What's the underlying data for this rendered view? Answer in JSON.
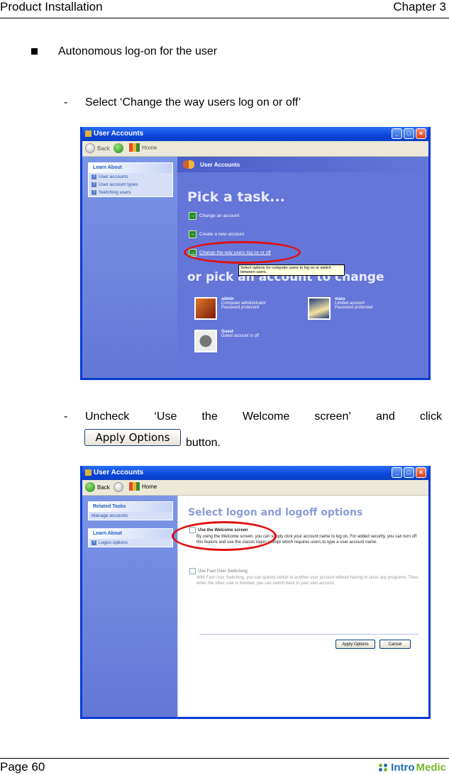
{
  "page": {
    "header_left": "Product Installation",
    "header_right": "Chapter 3",
    "footer_left": "Page 60",
    "logo": {
      "part1": "Intro",
      "part2": "Medic",
      "colors": [
        "#1e6fae",
        "#77b82a"
      ]
    }
  },
  "content": {
    "bullet": "Autonomous log-on for the user",
    "step1_dash": "-",
    "step1": "Select ‘Change the way users log on or off’",
    "step2_dash": "-",
    "step2_words": [
      "Uncheck",
      "‘Use",
      "the",
      "Welcome",
      "screen’",
      "and",
      "click"
    ],
    "step2_button": "Apply Options",
    "step2_suffix": "button."
  },
  "screenshot1": {
    "title": "User Accounts",
    "toolbar": {
      "back": "Back",
      "home": "Home"
    },
    "window_buttons": {
      "minimize": "_",
      "maximize": "□",
      "close": "×"
    },
    "learn_about": {
      "title": "Learn About",
      "items": [
        "User accounts",
        "User account types",
        "Switching users"
      ]
    },
    "main_header": "User Accounts",
    "pick_task": "Pick a task...",
    "tasks": [
      "Change an account",
      "Create a new account",
      "Change the way users log on or off"
    ],
    "tooltip": "Select options for computer users to log on or switch between users.",
    "pick_account": "or pick an account to change",
    "accounts": [
      {
        "name": "admin",
        "lines": [
          "Computer administrator",
          "Password protected"
        ],
        "color": "#a8341c"
      },
      {
        "name": "mara",
        "lines": [
          "Limited account",
          "Password protected"
        ],
        "color": "#2d5a9a"
      },
      {
        "name": "Guest",
        "lines": [
          "Guest account is off"
        ],
        "color": "#6b6b6b"
      }
    ],
    "highlight_color": "#e01010"
  },
  "screenshot2": {
    "title": "User Accounts",
    "toolbar": {
      "back": "Back",
      "home": "Home"
    },
    "window_buttons": {
      "minimize": "_",
      "maximize": "□",
      "close": "×"
    },
    "related_tasks": {
      "title": "Related Tasks",
      "items": [
        "Manage accounts"
      ]
    },
    "learn_about": {
      "title": "Learn About",
      "items": [
        "Logon options"
      ]
    },
    "heading": "Select logon and logoff options",
    "options": [
      {
        "label": "Use the Welcome screen",
        "checked": false,
        "description": "By using the Welcome screen, you can simply click your account name to log on. For added security, you can turn off this feature and use the classic logon prompt which requires users to type a user account name."
      },
      {
        "label": "Use Fast User Switching",
        "checked": false,
        "disabled": true,
        "description": "With Fast User Switching, you can quickly switch to another user account without having to close any programs. Then, when the other user is finished, you can switch back to your own account."
      }
    ],
    "buttons": {
      "apply": "Apply Options",
      "cancel": "Cancel"
    }
  }
}
